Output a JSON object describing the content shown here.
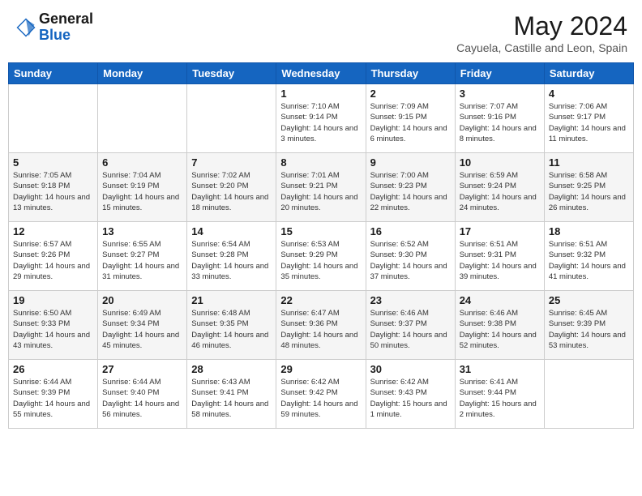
{
  "header": {
    "logo_general": "General",
    "logo_blue": "Blue",
    "month_year": "May 2024",
    "location": "Cayuela, Castille and Leon, Spain"
  },
  "calendar": {
    "days_of_week": [
      "Sunday",
      "Monday",
      "Tuesday",
      "Wednesday",
      "Thursday",
      "Friday",
      "Saturday"
    ],
    "weeks": [
      [
        {
          "day": "",
          "info": ""
        },
        {
          "day": "",
          "info": ""
        },
        {
          "day": "",
          "info": ""
        },
        {
          "day": "1",
          "info": "Sunrise: 7:10 AM\nSunset: 9:14 PM\nDaylight: 14 hours and 3 minutes."
        },
        {
          "day": "2",
          "info": "Sunrise: 7:09 AM\nSunset: 9:15 PM\nDaylight: 14 hours and 6 minutes."
        },
        {
          "day": "3",
          "info": "Sunrise: 7:07 AM\nSunset: 9:16 PM\nDaylight: 14 hours and 8 minutes."
        },
        {
          "day": "4",
          "info": "Sunrise: 7:06 AM\nSunset: 9:17 PM\nDaylight: 14 hours and 11 minutes."
        }
      ],
      [
        {
          "day": "5",
          "info": "Sunrise: 7:05 AM\nSunset: 9:18 PM\nDaylight: 14 hours and 13 minutes."
        },
        {
          "day": "6",
          "info": "Sunrise: 7:04 AM\nSunset: 9:19 PM\nDaylight: 14 hours and 15 minutes."
        },
        {
          "day": "7",
          "info": "Sunrise: 7:02 AM\nSunset: 9:20 PM\nDaylight: 14 hours and 18 minutes."
        },
        {
          "day": "8",
          "info": "Sunrise: 7:01 AM\nSunset: 9:21 PM\nDaylight: 14 hours and 20 minutes."
        },
        {
          "day": "9",
          "info": "Sunrise: 7:00 AM\nSunset: 9:23 PM\nDaylight: 14 hours and 22 minutes."
        },
        {
          "day": "10",
          "info": "Sunrise: 6:59 AM\nSunset: 9:24 PM\nDaylight: 14 hours and 24 minutes."
        },
        {
          "day": "11",
          "info": "Sunrise: 6:58 AM\nSunset: 9:25 PM\nDaylight: 14 hours and 26 minutes."
        }
      ],
      [
        {
          "day": "12",
          "info": "Sunrise: 6:57 AM\nSunset: 9:26 PM\nDaylight: 14 hours and 29 minutes."
        },
        {
          "day": "13",
          "info": "Sunrise: 6:55 AM\nSunset: 9:27 PM\nDaylight: 14 hours and 31 minutes."
        },
        {
          "day": "14",
          "info": "Sunrise: 6:54 AM\nSunset: 9:28 PM\nDaylight: 14 hours and 33 minutes."
        },
        {
          "day": "15",
          "info": "Sunrise: 6:53 AM\nSunset: 9:29 PM\nDaylight: 14 hours and 35 minutes."
        },
        {
          "day": "16",
          "info": "Sunrise: 6:52 AM\nSunset: 9:30 PM\nDaylight: 14 hours and 37 minutes."
        },
        {
          "day": "17",
          "info": "Sunrise: 6:51 AM\nSunset: 9:31 PM\nDaylight: 14 hours and 39 minutes."
        },
        {
          "day": "18",
          "info": "Sunrise: 6:51 AM\nSunset: 9:32 PM\nDaylight: 14 hours and 41 minutes."
        }
      ],
      [
        {
          "day": "19",
          "info": "Sunrise: 6:50 AM\nSunset: 9:33 PM\nDaylight: 14 hours and 43 minutes."
        },
        {
          "day": "20",
          "info": "Sunrise: 6:49 AM\nSunset: 9:34 PM\nDaylight: 14 hours and 45 minutes."
        },
        {
          "day": "21",
          "info": "Sunrise: 6:48 AM\nSunset: 9:35 PM\nDaylight: 14 hours and 46 minutes."
        },
        {
          "day": "22",
          "info": "Sunrise: 6:47 AM\nSunset: 9:36 PM\nDaylight: 14 hours and 48 minutes."
        },
        {
          "day": "23",
          "info": "Sunrise: 6:46 AM\nSunset: 9:37 PM\nDaylight: 14 hours and 50 minutes."
        },
        {
          "day": "24",
          "info": "Sunrise: 6:46 AM\nSunset: 9:38 PM\nDaylight: 14 hours and 52 minutes."
        },
        {
          "day": "25",
          "info": "Sunrise: 6:45 AM\nSunset: 9:39 PM\nDaylight: 14 hours and 53 minutes."
        }
      ],
      [
        {
          "day": "26",
          "info": "Sunrise: 6:44 AM\nSunset: 9:39 PM\nDaylight: 14 hours and 55 minutes."
        },
        {
          "day": "27",
          "info": "Sunrise: 6:44 AM\nSunset: 9:40 PM\nDaylight: 14 hours and 56 minutes."
        },
        {
          "day": "28",
          "info": "Sunrise: 6:43 AM\nSunset: 9:41 PM\nDaylight: 14 hours and 58 minutes."
        },
        {
          "day": "29",
          "info": "Sunrise: 6:42 AM\nSunset: 9:42 PM\nDaylight: 14 hours and 59 minutes."
        },
        {
          "day": "30",
          "info": "Sunrise: 6:42 AM\nSunset: 9:43 PM\nDaylight: 15 hours and 1 minute."
        },
        {
          "day": "31",
          "info": "Sunrise: 6:41 AM\nSunset: 9:44 PM\nDaylight: 15 hours and 2 minutes."
        },
        {
          "day": "",
          "info": ""
        }
      ]
    ]
  }
}
